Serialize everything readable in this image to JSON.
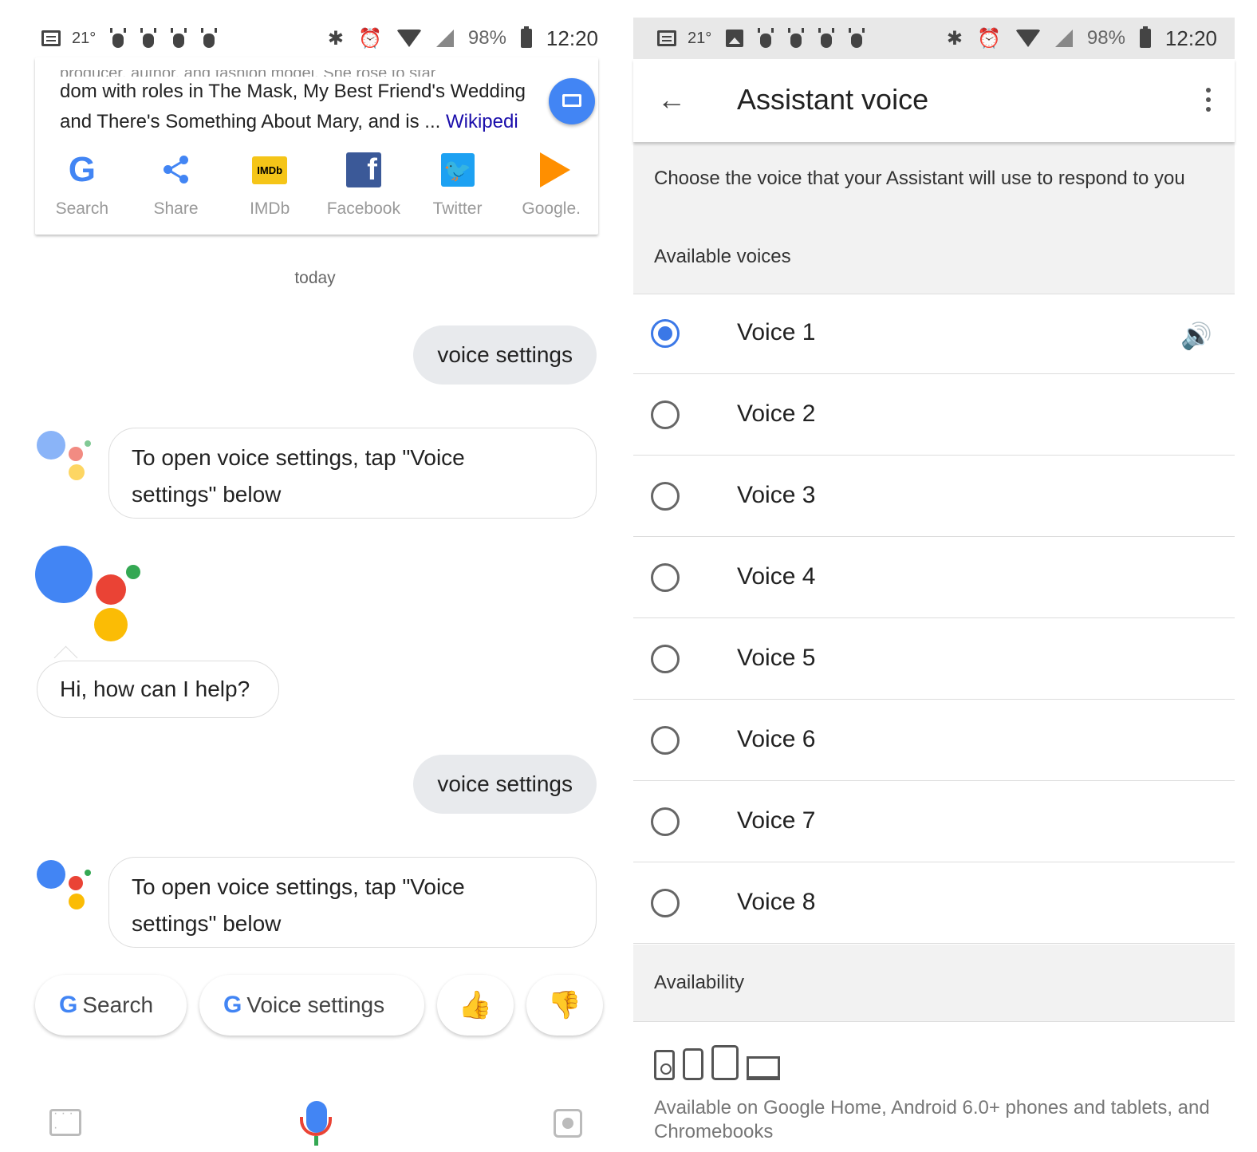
{
  "status_left": {
    "temperature": "21°",
    "battery": "98%",
    "time": "12:20"
  },
  "status_right": {
    "temperature": "21°",
    "battery": "98%",
    "time": "12:20"
  },
  "card": {
    "snippet_cut": "producer, author, and fashion model. She rose to star",
    "snippet_line1": "dom with roles in The Mask, My Best Friend's Wedding",
    "snippet_line2": "and There's Something About Mary, and is ... ",
    "snippet_link": "Wikipedi",
    "apps": [
      {
        "label": "Search",
        "icon": "google-g-icon"
      },
      {
        "label": "Share",
        "icon": "share-icon"
      },
      {
        "label": "IMDb",
        "icon": "imdb-icon"
      },
      {
        "label": "Facebook",
        "icon": "facebook-icon"
      },
      {
        "label": "Twitter",
        "icon": "twitter-icon"
      },
      {
        "label": "Google.",
        "icon": "google-play-icon"
      }
    ]
  },
  "conversation": {
    "date_label": "today",
    "user_msg_1": "voice settings",
    "bot_msg_1_l1": "To open voice settings, tap \"Voice",
    "bot_msg_1_l2": "settings\" below",
    "greeting": "Hi, how can I help?",
    "user_msg_2": "voice settings",
    "bot_msg_2_l1": "To open voice settings, tap \"Voice",
    "bot_msg_2_l2": "settings\" below"
  },
  "chips": {
    "search": "Search",
    "voice_settings": "Voice settings",
    "thumbs_up_icon": "thumbs-up-icon",
    "thumbs_down_icon": "thumbs-down-icon"
  },
  "settings": {
    "title": "Assistant voice",
    "description": "Choose the voice that your Assistant will use to respond to you",
    "available_voices_label": "Available voices",
    "voices": [
      "Voice 1",
      "Voice 2",
      "Voice 3",
      "Voice 4",
      "Voice 5",
      "Voice 6",
      "Voice 7",
      "Voice 8"
    ],
    "selected_voice": "Voice 1",
    "availability_label": "Availability",
    "availability_text": "Available on Google Home, Android 6.0+ phones and tablets, and Chromebooks"
  },
  "colors": {
    "accent_blue": "#3b78e7",
    "google_blue": "#4285f4",
    "google_red": "#ea4335",
    "google_yellow": "#fbbc05",
    "google_green": "#34a853"
  }
}
